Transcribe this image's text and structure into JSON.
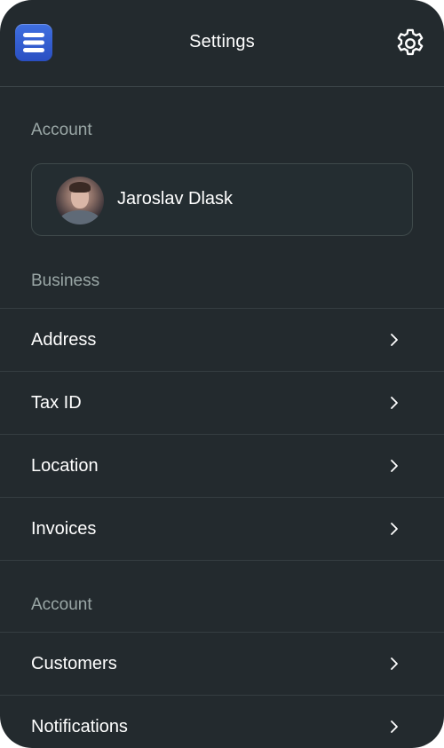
{
  "header": {
    "title": "Settings",
    "logo_icon": "stacked-layers-icon",
    "settings_icon": "gear-icon"
  },
  "account_section": {
    "label": "Account",
    "user": {
      "name": "Jaroslav Dlask",
      "avatar_icon": "user-avatar"
    }
  },
  "business_section": {
    "label": "Business",
    "items": [
      {
        "label": "Address",
        "icon": "chevron-right-icon"
      },
      {
        "label": "Tax ID",
        "icon": "chevron-right-icon"
      },
      {
        "label": "Location",
        "icon": "chevron-right-icon"
      },
      {
        "label": "Invoices",
        "icon": "chevron-right-icon"
      }
    ]
  },
  "account_section_2": {
    "label": "Account",
    "items": [
      {
        "label": "Customers",
        "icon": "chevron-right-icon"
      },
      {
        "label": "Notifications",
        "icon": "chevron-right-icon"
      }
    ]
  },
  "colors": {
    "background": "#232a2e",
    "accent": "#3557d6",
    "muted_text": "#9aa7a6",
    "divider": "#353e42"
  }
}
